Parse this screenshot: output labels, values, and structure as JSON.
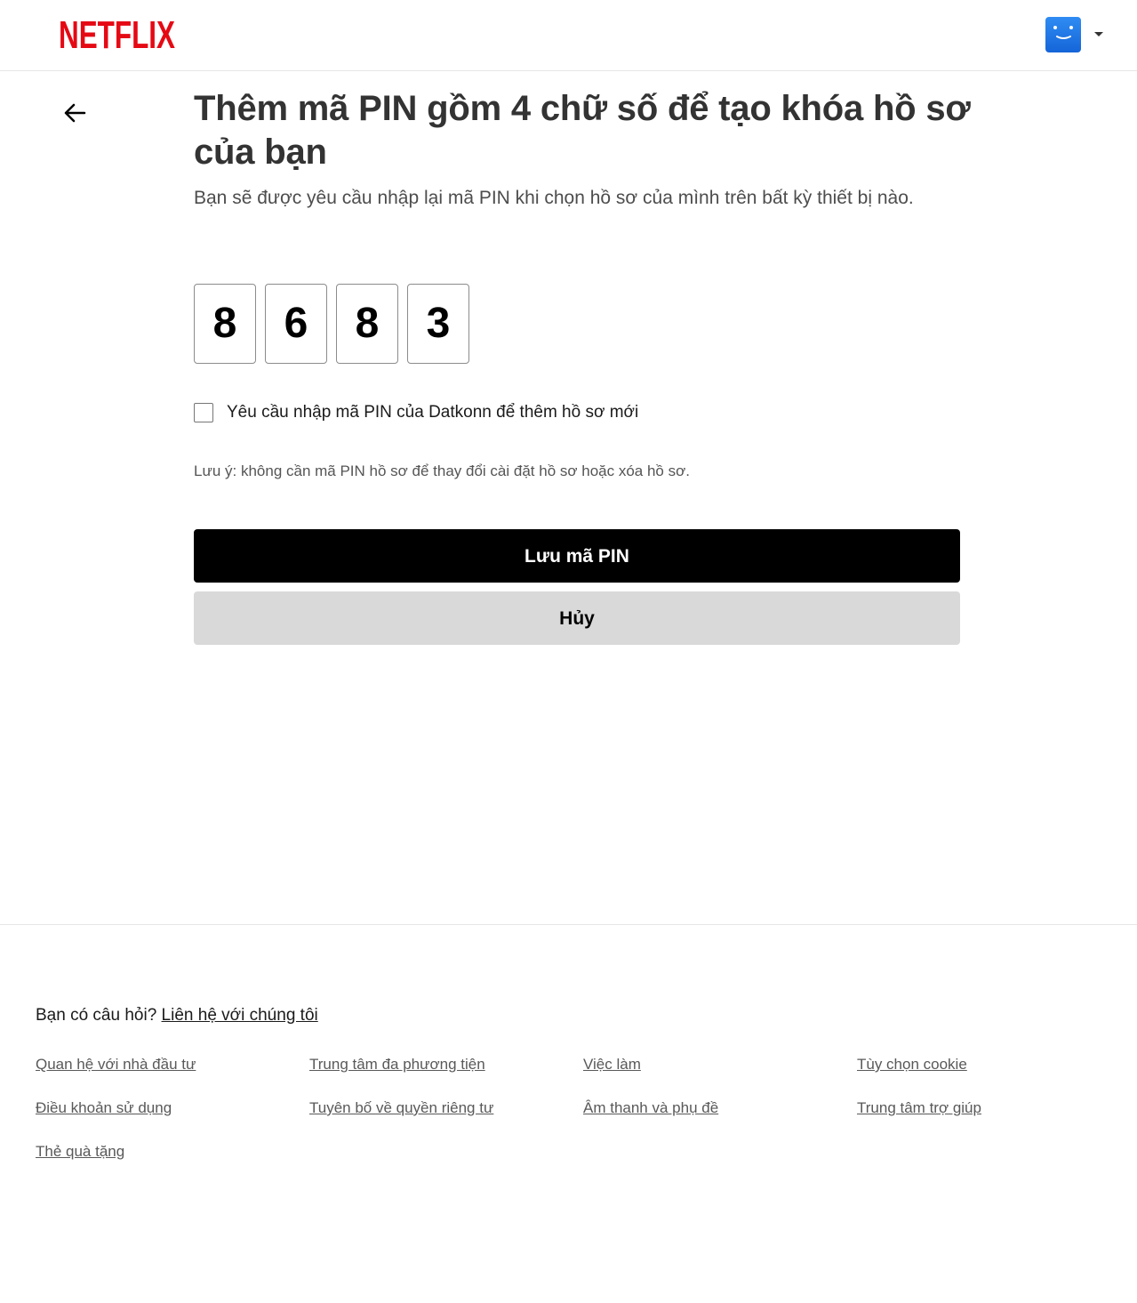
{
  "header": {
    "logo_text": "NETFLIX",
    "logo_color": "#e50914",
    "avatar_color": "#1f7aeb"
  },
  "main": {
    "back_icon": "arrow-left-icon",
    "title": "Thêm mã PIN gồm 4 chữ số để tạo khóa hồ sơ của bạn",
    "subtitle": "Bạn sẽ được yêu cầu nhập lại mã PIN khi chọn hồ sơ của mình trên bất kỳ thiết bị nào.",
    "pin_digits": [
      "8",
      "6",
      "8",
      "3"
    ],
    "checkbox_label": "Yêu cầu nhập mã PIN của Datkonn để thêm hồ sơ mới",
    "checkbox_checked": false,
    "note": "Lưu ý: không cần mã PIN hồ sơ để thay đổi cài đặt hồ sơ hoặc xóa hồ sơ.",
    "save_label": "Lưu mã PIN",
    "cancel_label": "Hủy"
  },
  "footer": {
    "question": "Bạn có câu hỏi?",
    "contact_label": "Liên hệ với chúng tôi",
    "links": [
      "Quan hệ với nhà đầu tư",
      "Trung tâm đa phương tiện",
      "Việc làm",
      "Tùy chọn cookie",
      "Điều khoản sử dụng",
      "Tuyên bố về quyền riêng tư",
      "Âm thanh và phụ đề",
      "Trung tâm trợ giúp",
      "Thẻ quà tặng"
    ]
  }
}
